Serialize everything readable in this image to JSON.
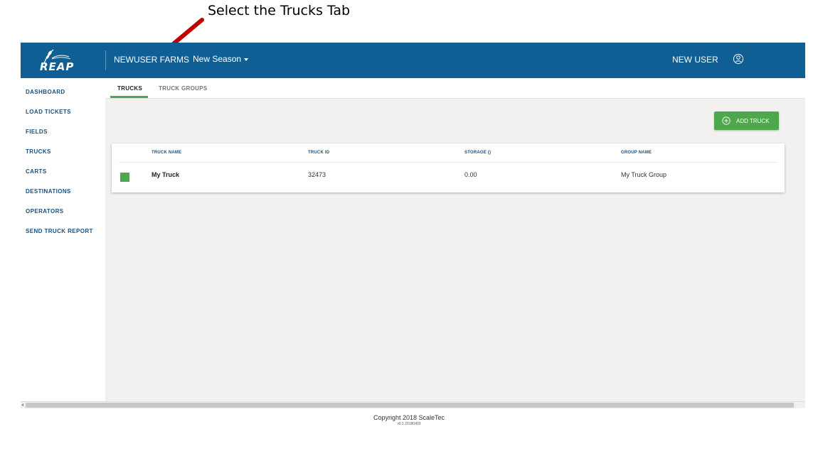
{
  "annotation": {
    "text": "Select the Trucks Tab",
    "arrow_color": "#c00000"
  },
  "header": {
    "logo_text": "REAP",
    "org_name": "NEWUSER FARMS",
    "season": "New Season",
    "user_name": "NEW USER",
    "background_color": "#0f5f95"
  },
  "sidebar": {
    "items": [
      {
        "label": "DASHBOARD"
      },
      {
        "label": "LOAD TICKETS"
      },
      {
        "label": "FIELDS"
      },
      {
        "label": "TRUCKS"
      },
      {
        "label": "CARTS"
      },
      {
        "label": "DESTINATIONS"
      },
      {
        "label": "OPERATORS"
      },
      {
        "label": "SEND TRUCK REPORT"
      }
    ]
  },
  "tabs": [
    {
      "label": "TRUCKS",
      "active": true
    },
    {
      "label": "TRUCK GROUPS",
      "active": false
    }
  ],
  "toolbar": {
    "add_truck_label": "ADD TRUCK",
    "accent_color": "#4ea74c"
  },
  "table": {
    "columns": [
      "TRUCK NAME",
      "TRUCK ID",
      "STORAGE ()",
      "GROUP NAME"
    ],
    "rows": [
      {
        "color": "#4ea74c",
        "name": "My Truck",
        "id": "32473",
        "storage": "0.00",
        "group": "My Truck Group"
      }
    ]
  },
  "footer": {
    "copyright": "Copyright 2018 ScaleTec",
    "version": "v0.1.20180403"
  }
}
